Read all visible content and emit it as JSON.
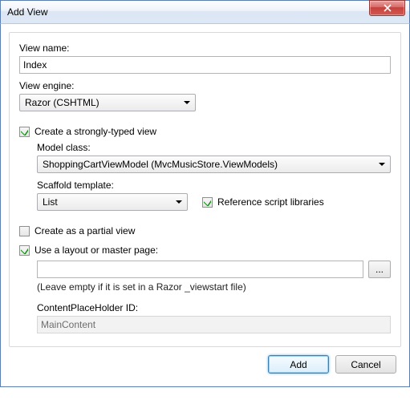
{
  "title": "Add View",
  "labels": {
    "viewName": "View name:",
    "viewEngine": "View engine:",
    "stronglyTyped": "Create a strongly-typed view",
    "modelClass": "Model class:",
    "scaffold": "Scaffold template:",
    "refScripts": "Reference script libraries",
    "partial": "Create as a partial view",
    "useLayout": "Use a layout or master page:",
    "layoutHint": "(Leave empty if it is set in a Razor _viewstart file)",
    "cph": "ContentPlaceHolder ID:"
  },
  "values": {
    "viewName": "Index",
    "viewEngine": "Razor (CSHTML)",
    "modelClass": "ShoppingCartViewModel (MvcMusicStore.ViewModels)",
    "scaffold": "List",
    "layoutPath": "",
    "cph": "MainContent"
  },
  "checks": {
    "stronglyTyped": true,
    "refScripts": true,
    "partial": false,
    "useLayout": true
  },
  "buttons": {
    "add": "Add",
    "cancel": "Cancel",
    "browse": "..."
  }
}
